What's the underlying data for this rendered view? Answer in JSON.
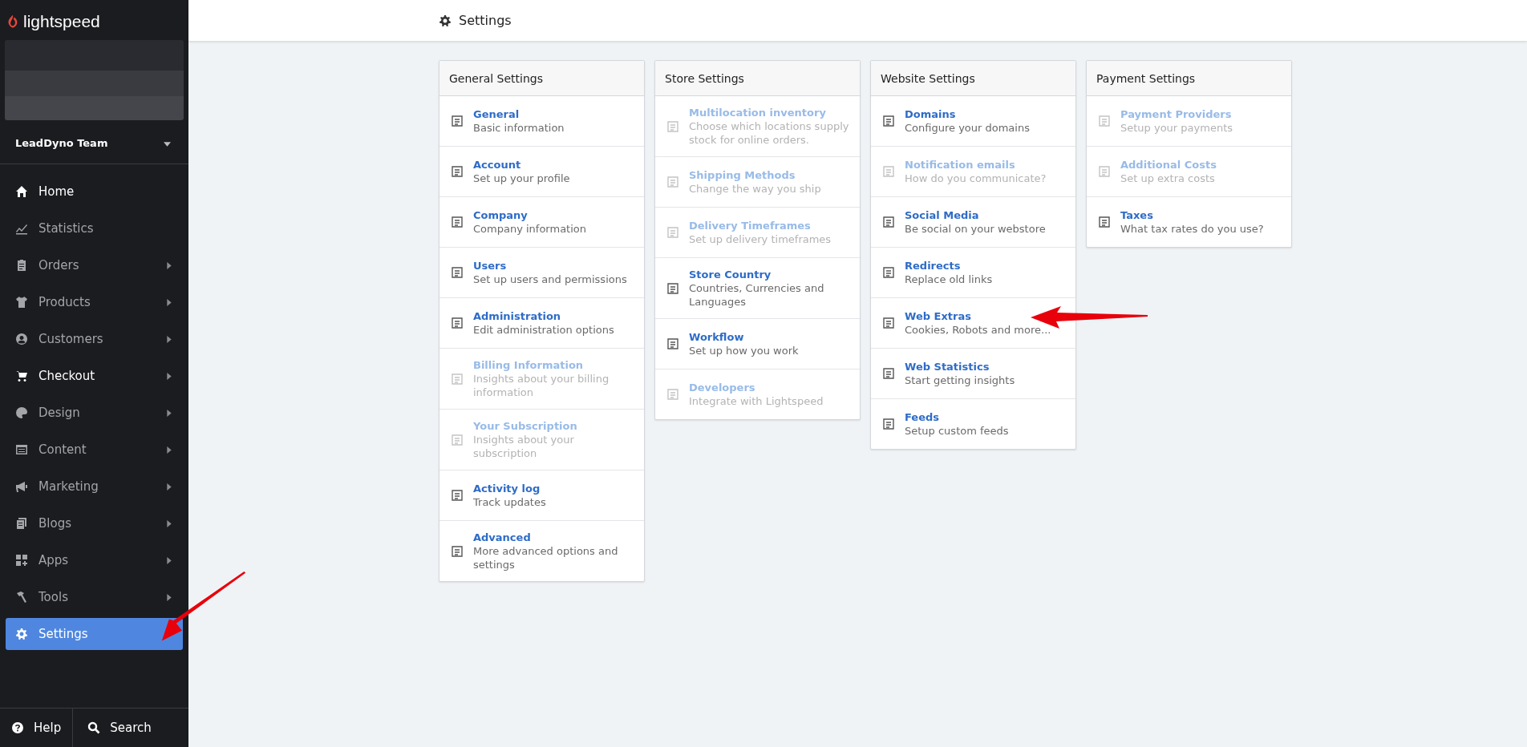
{
  "sidebar": {
    "brand": "lightspeed",
    "team": "LeadDyno Team",
    "nav": [
      {
        "label": "Home",
        "bright": true,
        "expandable": false,
        "selected": false
      },
      {
        "label": "Statistics",
        "bright": false,
        "expandable": false,
        "selected": false
      },
      {
        "label": "Orders",
        "bright": false,
        "expandable": true,
        "selected": false
      },
      {
        "label": "Products",
        "bright": false,
        "expandable": true,
        "selected": false
      },
      {
        "label": "Customers",
        "bright": false,
        "expandable": true,
        "selected": false
      },
      {
        "label": "Checkout",
        "bright": true,
        "expandable": true,
        "selected": false
      },
      {
        "label": "Design",
        "bright": false,
        "expandable": true,
        "selected": false
      },
      {
        "label": "Content",
        "bright": false,
        "expandable": true,
        "selected": false
      },
      {
        "label": "Marketing",
        "bright": false,
        "expandable": true,
        "selected": false
      },
      {
        "label": "Blogs",
        "bright": false,
        "expandable": true,
        "selected": false
      },
      {
        "label": "Apps",
        "bright": false,
        "expandable": true,
        "selected": false
      },
      {
        "label": "Tools",
        "bright": false,
        "expandable": true,
        "selected": false
      },
      {
        "label": "Settings",
        "bright": true,
        "expandable": false,
        "selected": true
      }
    ],
    "footer": [
      "Help",
      "Search"
    ]
  },
  "header": {
    "title": "Settings"
  },
  "cards": [
    {
      "title": "General Settings",
      "items": [
        {
          "title": "General",
          "description": "Basic information",
          "disabled": false
        },
        {
          "title": "Account",
          "description": "Set up your profile",
          "disabled": false
        },
        {
          "title": "Company",
          "description": "Company information",
          "disabled": false
        },
        {
          "title": "Users",
          "description": "Set up users and permissions",
          "disabled": false
        },
        {
          "title": "Administration",
          "description": "Edit administration options",
          "disabled": false
        },
        {
          "title": "Billing Information",
          "description": "Insights about your billing information",
          "disabled": true
        },
        {
          "title": "Your Subscription",
          "description": "Insights about your subscription",
          "disabled": true
        },
        {
          "title": "Activity log",
          "description": "Track updates",
          "disabled": false
        },
        {
          "title": "Advanced",
          "description": "More advanced options and settings",
          "disabled": false
        }
      ]
    },
    {
      "title": "Store Settings",
      "items": [
        {
          "title": "Multilocation inventory",
          "description": "Choose which locations supply stock for online orders.",
          "disabled": true
        },
        {
          "title": "Shipping Methods",
          "description": "Change the way you ship",
          "disabled": true
        },
        {
          "title": "Delivery Timeframes",
          "description": "Set up delivery timeframes",
          "disabled": true
        },
        {
          "title": "Store Country",
          "description": "Countries, Currencies and Languages",
          "disabled": false
        },
        {
          "title": "Workflow",
          "description": "Set up how you work",
          "disabled": false
        },
        {
          "title": "Developers",
          "description": "Integrate with Lightspeed",
          "disabled": true
        }
      ]
    },
    {
      "title": "Website Settings",
      "items": [
        {
          "title": "Domains",
          "description": "Configure your domains",
          "disabled": false
        },
        {
          "title": "Notification emails",
          "description": "How do you communicate?",
          "disabled": true
        },
        {
          "title": "Social Media",
          "description": "Be social on your webstore",
          "disabled": false
        },
        {
          "title": "Redirects",
          "description": "Replace old links",
          "disabled": false
        },
        {
          "title": "Web Extras",
          "description": "Cookies, Robots and more...",
          "disabled": false
        },
        {
          "title": "Web Statistics",
          "description": "Start getting insights",
          "disabled": false
        },
        {
          "title": "Feeds",
          "description": "Setup custom feeds",
          "disabled": false
        }
      ]
    },
    {
      "title": "Payment Settings",
      "items": [
        {
          "title": "Payment Providers",
          "description": "Setup your payments",
          "disabled": true
        },
        {
          "title": "Additional Costs",
          "description": "Set up extra costs",
          "disabled": true
        },
        {
          "title": "Taxes",
          "description": "What tax rates do you use?",
          "disabled": false
        }
      ]
    }
  ]
}
